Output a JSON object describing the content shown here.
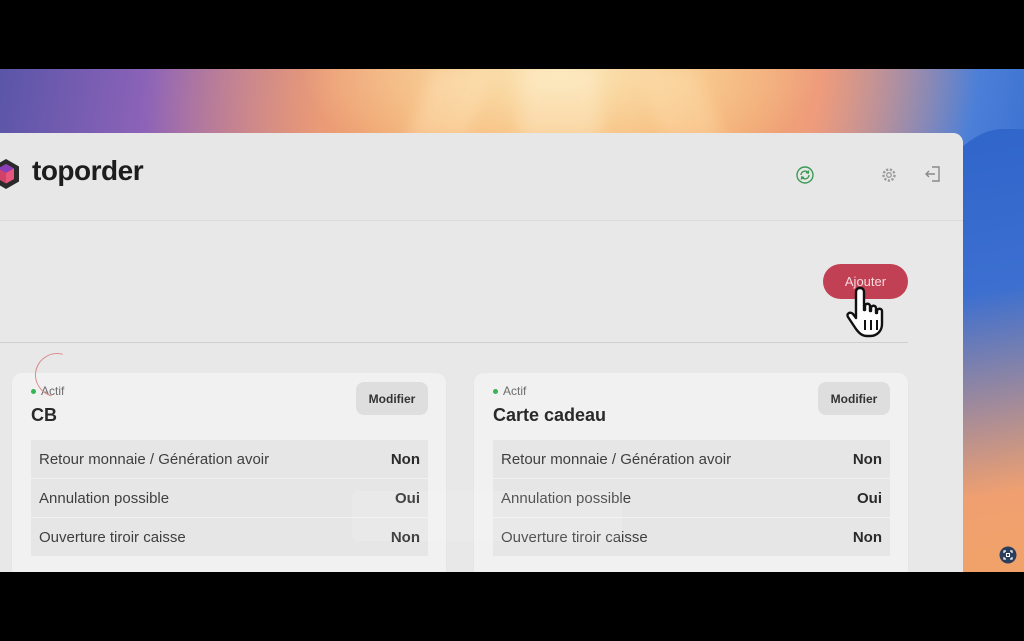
{
  "brand": {
    "name": "toporder"
  },
  "toolbar": {
    "add_label": "Ajouter"
  },
  "icons": {
    "sync": "sync-icon",
    "settings": "gear-icon",
    "logout": "logout-icon",
    "cursor": "hand-pointer-icon",
    "screenshot": "screenshot-icon"
  },
  "colors": {
    "accent": "#c24053",
    "active": "#34b454"
  },
  "cards": [
    {
      "status": "Actif",
      "title": "CB",
      "edit_label": "Modifier",
      "rows": [
        {
          "label": "Retour monnaie / Génération avoir",
          "value": "Non"
        },
        {
          "label": "Annulation possible",
          "value": "Oui"
        },
        {
          "label": "Ouverture tiroir caisse",
          "value": "Non"
        }
      ]
    },
    {
      "status": "Actif",
      "title": "Carte cadeau",
      "edit_label": "Modifier",
      "rows": [
        {
          "label": "Retour monnaie / Génération avoir",
          "value": "Non"
        },
        {
          "label": "Annulation possible",
          "value": "Oui"
        },
        {
          "label": "Ouverture tiroir caisse",
          "value": "Non"
        }
      ]
    }
  ]
}
